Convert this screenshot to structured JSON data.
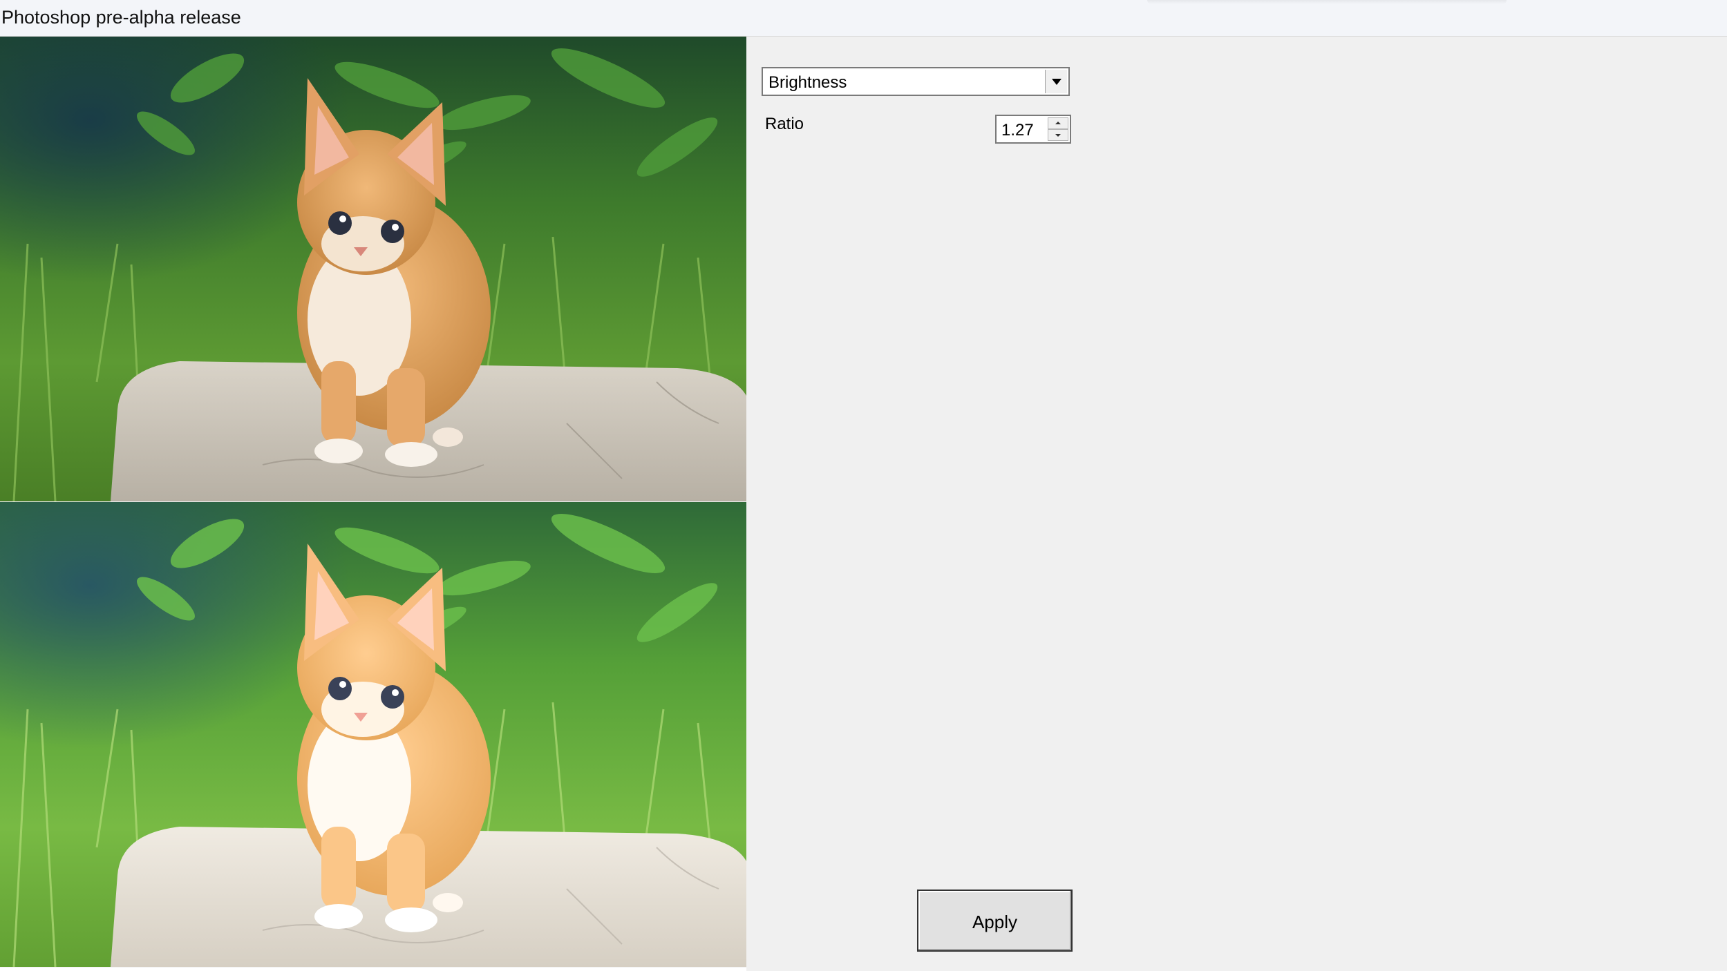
{
  "window": {
    "title": "Photoshop pre-alpha release"
  },
  "images": {
    "original": {
      "description_icon": "kitten-photo",
      "filter_applied": false
    },
    "processed": {
      "description_icon": "kitten-photo",
      "filter_applied": true
    }
  },
  "controls": {
    "filter_select": {
      "selected": "Brightness"
    },
    "ratio": {
      "label": "Ratio",
      "value": "1.27"
    },
    "apply_label": "Apply"
  },
  "colors": {
    "window_bg": "#f0f0f0",
    "titlebar_bg": "#f3f5f9",
    "grass": "#4f8a2a",
    "kitten": "#e0a060",
    "rock": "#cfc8bc"
  }
}
